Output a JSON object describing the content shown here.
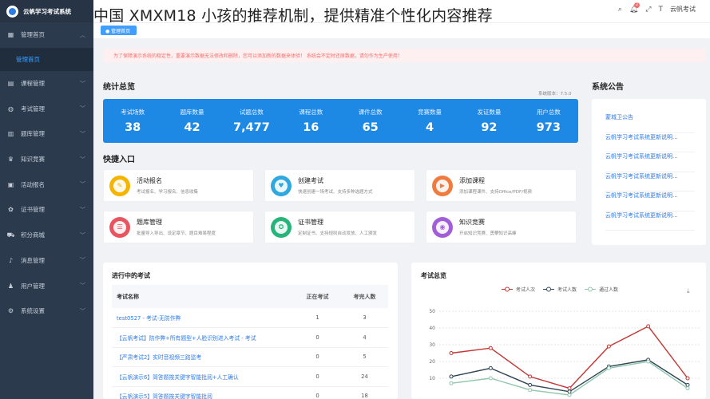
{
  "app": {
    "title": "云帆学习考试系统"
  },
  "overlay": {
    "text": "中国 XMXM18 小孩的推荐机制，提供精准个性化内容推荐"
  },
  "sidebar": {
    "items": [
      {
        "label": "管理首页",
        "icon": "home-icon"
      },
      {
        "label": "课程管理",
        "icon": "book-icon"
      },
      {
        "label": "考试管理",
        "icon": "exam-icon"
      },
      {
        "label": "题库管理",
        "icon": "database-icon"
      },
      {
        "label": "知识竞赛",
        "icon": "trophy-icon"
      },
      {
        "label": "活动报名",
        "icon": "calendar-icon"
      },
      {
        "label": "证书管理",
        "icon": "certificate-icon"
      },
      {
        "label": "积分商城",
        "icon": "cart-icon"
      },
      {
        "label": "消息管理",
        "icon": "bell-icon"
      },
      {
        "label": "用户管理",
        "icon": "user-icon"
      },
      {
        "label": "系统设置",
        "icon": "gear-icon"
      }
    ],
    "sub_active": "管理首页"
  },
  "topbar": {
    "user": "云帆考试",
    "notification_count": "2"
  },
  "notice": {
    "text": "为了保障演示系统的稳定性，重要演示数据无法修改和删除，您可以添加新的数据来体验！ 系统会不定时还原数据，请勿作为生产使用！"
  },
  "stats_section": {
    "title": "统计总览",
    "version": "系统版本：7.5.0",
    "items": [
      {
        "label": "考试场数",
        "value": "38"
      },
      {
        "label": "题库数量",
        "value": "42"
      },
      {
        "label": "试题总数",
        "value": "7,477"
      },
      {
        "label": "课程总数",
        "value": "16"
      },
      {
        "label": "课件总数",
        "value": "65"
      },
      {
        "label": "竞赛数量",
        "value": "4"
      },
      {
        "label": "发证数量",
        "value": "92"
      },
      {
        "label": "用户总数",
        "value": "973"
      }
    ]
  },
  "quick_section": {
    "title": "快捷入口",
    "items": [
      {
        "title": "活动报名",
        "desc": "考试报名、学习报名、信息收集",
        "color": "#f5b400",
        "icon": "form-icon",
        "glyph": "✎"
      },
      {
        "title": "创建考试",
        "desc": "快速创建一场考试、支持多种选题方式",
        "color": "#2fa8e0",
        "icon": "heart-shield-icon",
        "glyph": "♥"
      },
      {
        "title": "添加课程",
        "desc": "添加课程课件、支持Office/PDF/视频",
        "color": "#f07b3f",
        "icon": "play-icon",
        "glyph": "▶"
      },
      {
        "title": "题库管理",
        "desc": "批量导入导出、设定章节、题目难易程度",
        "color": "#e8545f",
        "icon": "list-icon",
        "glyph": "☰"
      },
      {
        "title": "证书管理",
        "desc": "定制证书、支持规则自动发放、人工颁发",
        "color": "#27b47a",
        "icon": "medal-icon",
        "glyph": "✪"
      },
      {
        "title": "知识竞赛",
        "desc": "开启知识竞赛、勇攀知识高峰",
        "color": "#a25ed9",
        "icon": "broadcast-icon",
        "glyph": "◉"
      }
    ]
  },
  "announcements": {
    "title": "系统公告",
    "items": [
      "蒙城卫公告",
      "云帆学习考试系统更新说明...",
      "云帆学习考试系统更新说明...",
      "云帆学习考试系统更新说明...",
      "云帆学习考试系统更新说明...",
      "云帆学习考试系统更新说明..."
    ]
  },
  "exams_card": {
    "title": "进行中的考试",
    "columns": [
      "考试名称",
      "正在考试",
      "考完人数"
    ],
    "rows": [
      {
        "name": "test0527 - 考试-无防作弊",
        "ongoing": "1",
        "done": "3"
      },
      {
        "name": "【云帆考试】防作弊+所有题型+人脸识别进入考试 - 考试",
        "ongoing": "0",
        "done": "4"
      },
      {
        "name": "【严肃考试2】实时音视频三路监考",
        "ongoing": "0",
        "done": "5"
      },
      {
        "name": "【云帆演示6】简答题按关键字智能批阅+人工确认",
        "ongoing": "0",
        "done": "24"
      },
      {
        "name": "【云帆演示5】简答题按关键字智能批阅",
        "ongoing": "0",
        "done": "18"
      }
    ]
  },
  "chart_card": {
    "title": "考试总览"
  },
  "chart_data": {
    "type": "line",
    "title": "考试总览",
    "ylim": [
      0,
      50
    ],
    "yticks": [
      10,
      20,
      30,
      40,
      50
    ],
    "series": [
      {
        "name": "考试人次",
        "color": "#c23531",
        "values": [
          25,
          28,
          11,
          4,
          29,
          41,
          10
        ]
      },
      {
        "name": "考试人数",
        "color": "#2f4554",
        "values": [
          11,
          16,
          6,
          2,
          17,
          21,
          6
        ]
      },
      {
        "name": "通过人数",
        "color": "#91c7ae",
        "values": [
          7,
          10,
          3,
          0,
          16,
          20,
          4
        ]
      }
    ]
  }
}
